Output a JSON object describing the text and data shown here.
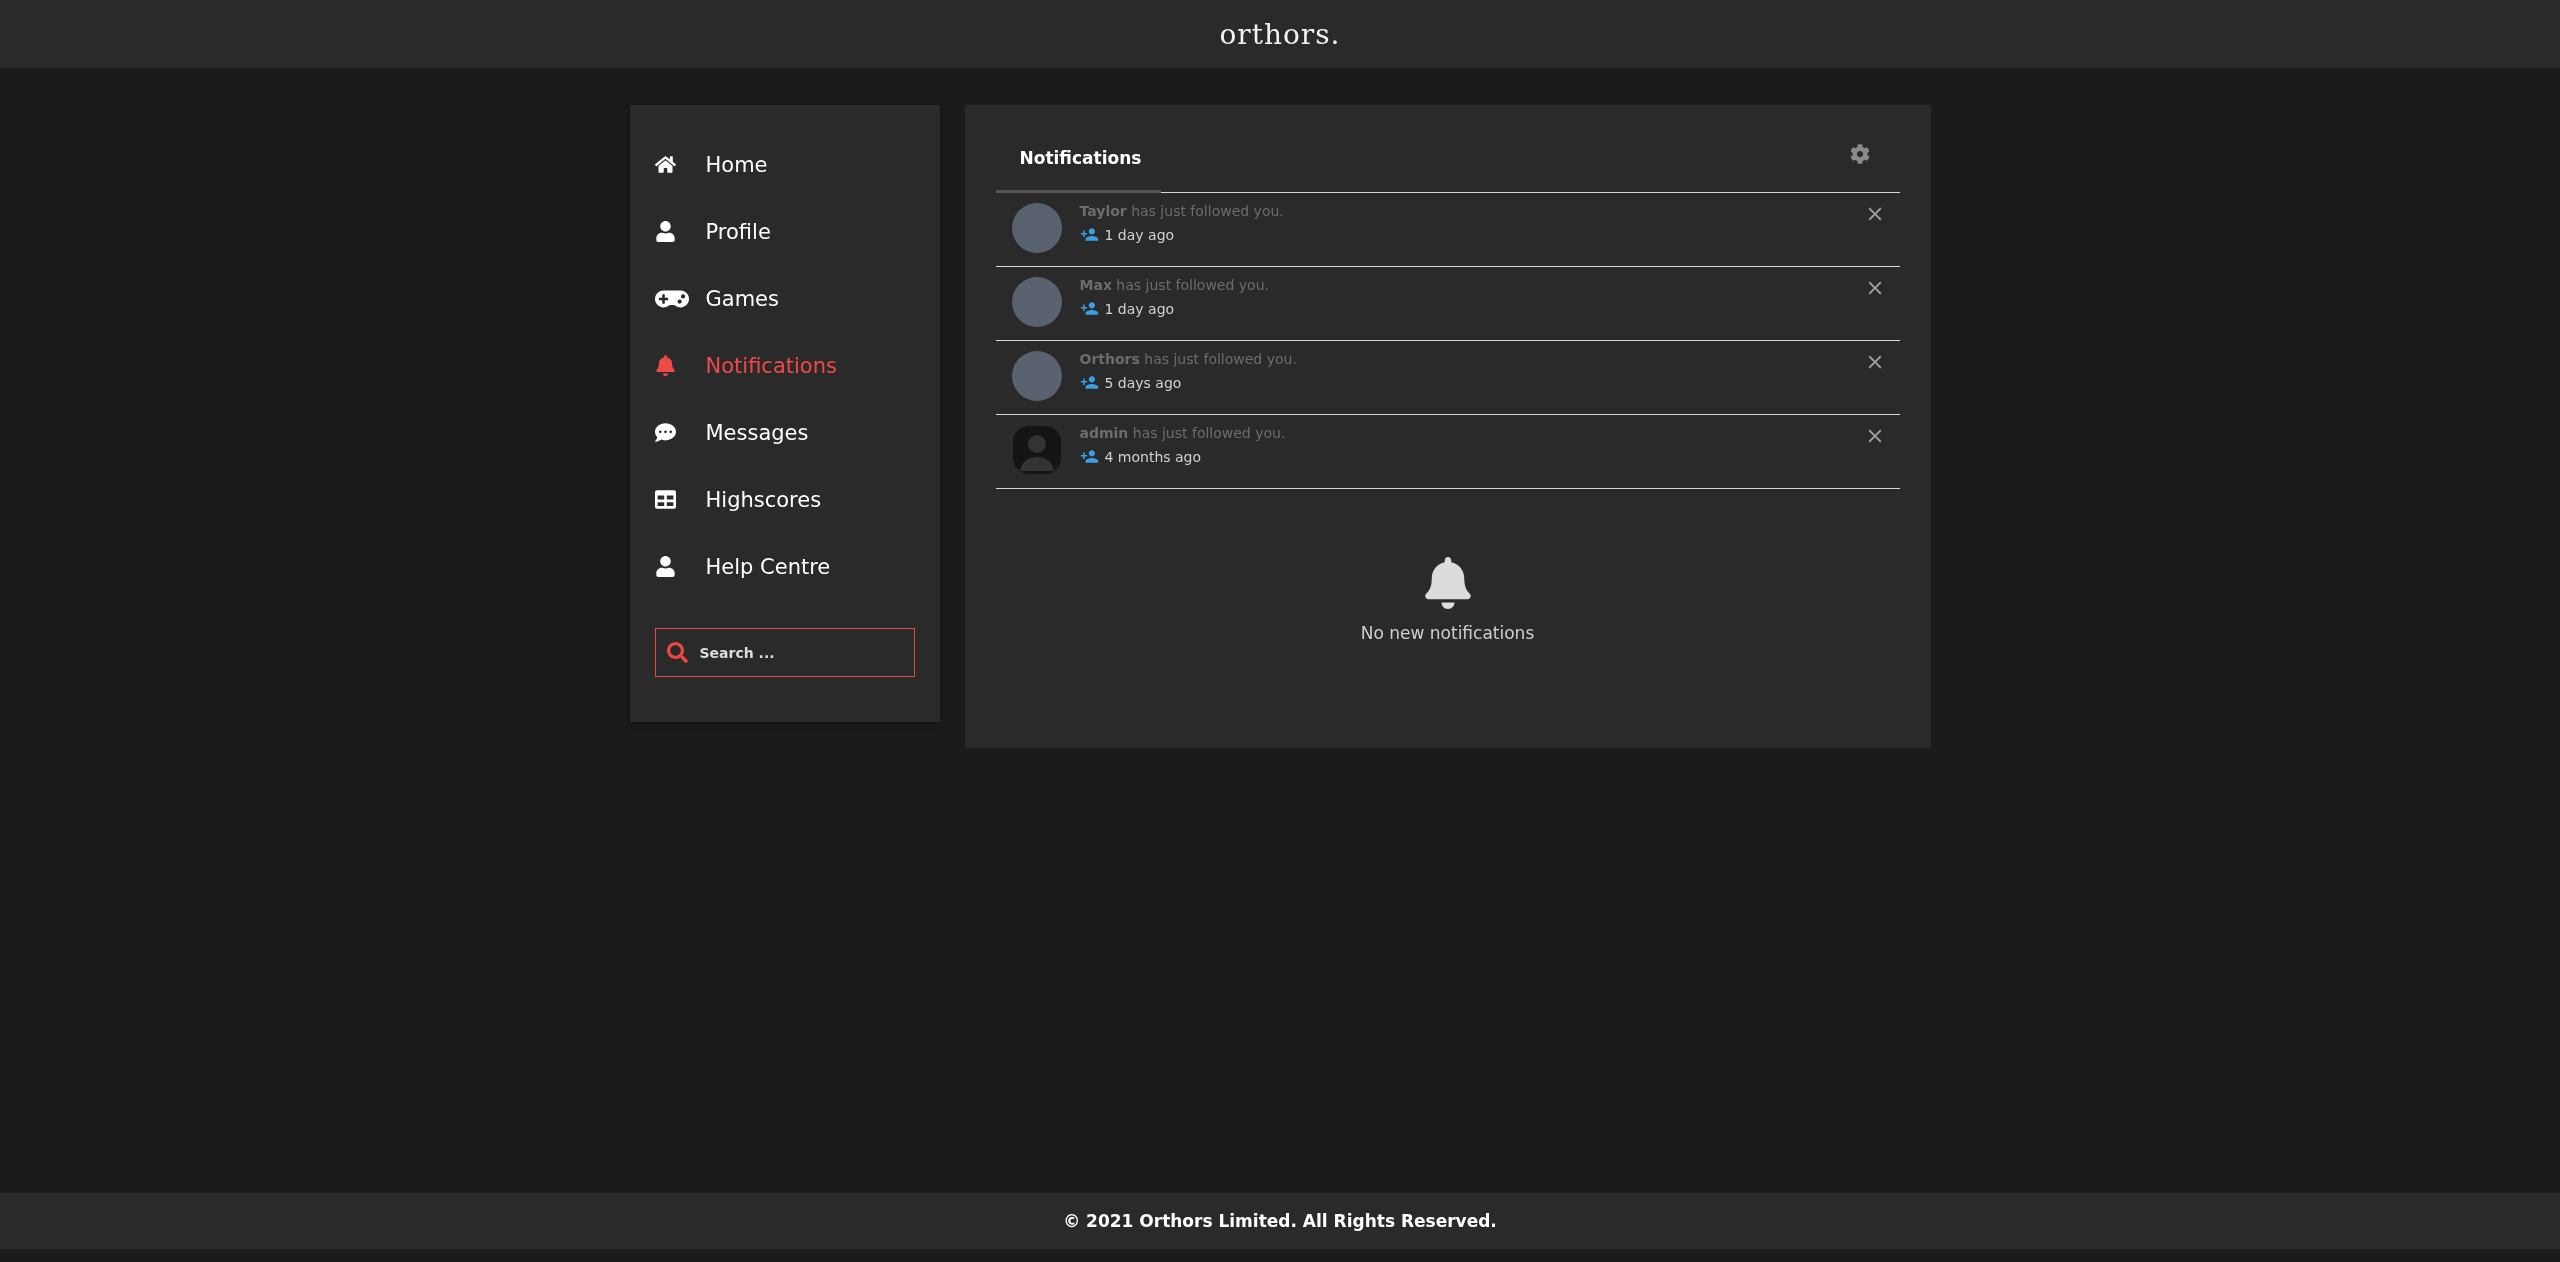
{
  "header": {
    "logo": "orthors."
  },
  "sidebar": {
    "items": [
      {
        "label": "Home",
        "selected": false
      },
      {
        "label": "Profile",
        "selected": false
      },
      {
        "label": "Games",
        "selected": false
      },
      {
        "label": "Notifications",
        "selected": true
      },
      {
        "label": "Messages",
        "selected": false
      },
      {
        "label": "Highscores",
        "selected": false
      },
      {
        "label": "Help Centre",
        "selected": false
      }
    ],
    "search": {
      "placeholder": "Search ..."
    }
  },
  "panel": {
    "tabs": [
      {
        "label": "Notifications",
        "selected": true
      }
    ],
    "notifications": [
      {
        "kind": "photo",
        "text": "**Taylor** has just followed you.",
        "time": "1 day ago"
      },
      {
        "kind": "photo",
        "text": "**Max** has just followed you.",
        "time": "1 day ago"
      },
      {
        "kind": "photo",
        "text": "**Orthors** has just followed you.",
        "time": "5 days ago"
      },
      {
        "kind": "default",
        "text": "**admin** has just followed you.",
        "time": "4 months ago"
      }
    ],
    "empty_message": "No new notifications"
  },
  "footer": {
    "text": "© 2021 Orthors Limited. All Rights Reserved."
  }
}
